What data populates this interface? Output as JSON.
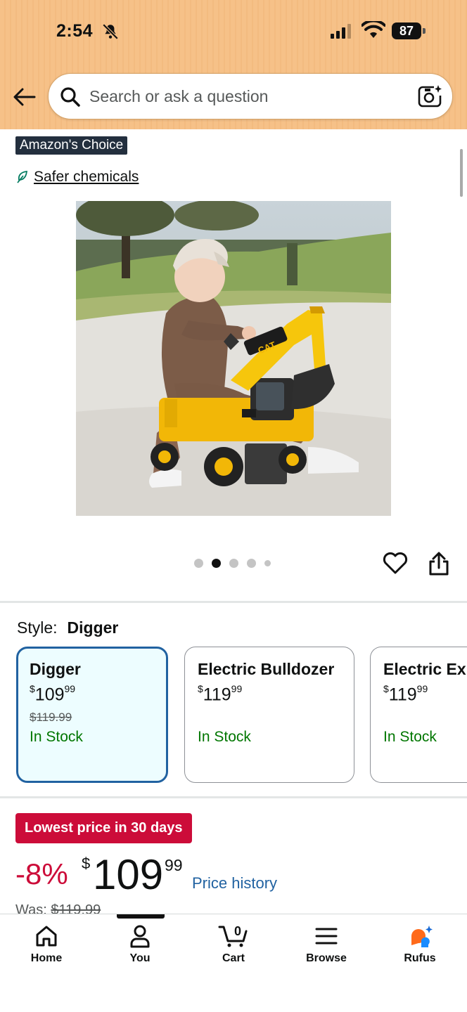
{
  "status_bar": {
    "time": "2:54",
    "battery": "87"
  },
  "search": {
    "placeholder": "Search or ask a question"
  },
  "badges": {
    "choice": "Amazon's Choice",
    "safer": "Safer chemicals"
  },
  "carousel": {
    "total_images": 5,
    "active_index": 1
  },
  "style": {
    "label": "Style:",
    "selected": "Digger",
    "variants": [
      {
        "name": "Digger",
        "price_whole": "109",
        "price_cents": "99",
        "was": "$119.99",
        "stock": "In Stock",
        "selected": true
      },
      {
        "name": "Electric Bulldozer",
        "price_whole": "119",
        "price_cents": "99",
        "was": "",
        "stock": "In Stock",
        "selected": false
      },
      {
        "name": "Electric Ex",
        "price_whole": "119",
        "price_cents": "99",
        "was": "",
        "stock": "In Stock",
        "selected": false
      }
    ]
  },
  "price": {
    "deal_badge": "Lowest price in 30 days",
    "discount": "-8%",
    "currency": "$",
    "whole": "109",
    "cents": "99",
    "history_link": "Price history",
    "was_label": "Was:",
    "was_value": "$119.99"
  },
  "bottom_nav": {
    "items": [
      {
        "label": "Home",
        "icon": "home-icon"
      },
      {
        "label": "You",
        "icon": "person-icon"
      },
      {
        "label": "Cart",
        "icon": "cart-icon",
        "count": "0"
      },
      {
        "label": "Browse",
        "icon": "menu-icon"
      },
      {
        "label": "Rufus",
        "icon": "rufus-icon"
      }
    ]
  },
  "colors": {
    "header_bg": "#f6c188",
    "deal_red": "#cc0c39",
    "link_blue": "#2162a1",
    "in_stock_green": "#007600",
    "selected_border": "#2162a1"
  }
}
